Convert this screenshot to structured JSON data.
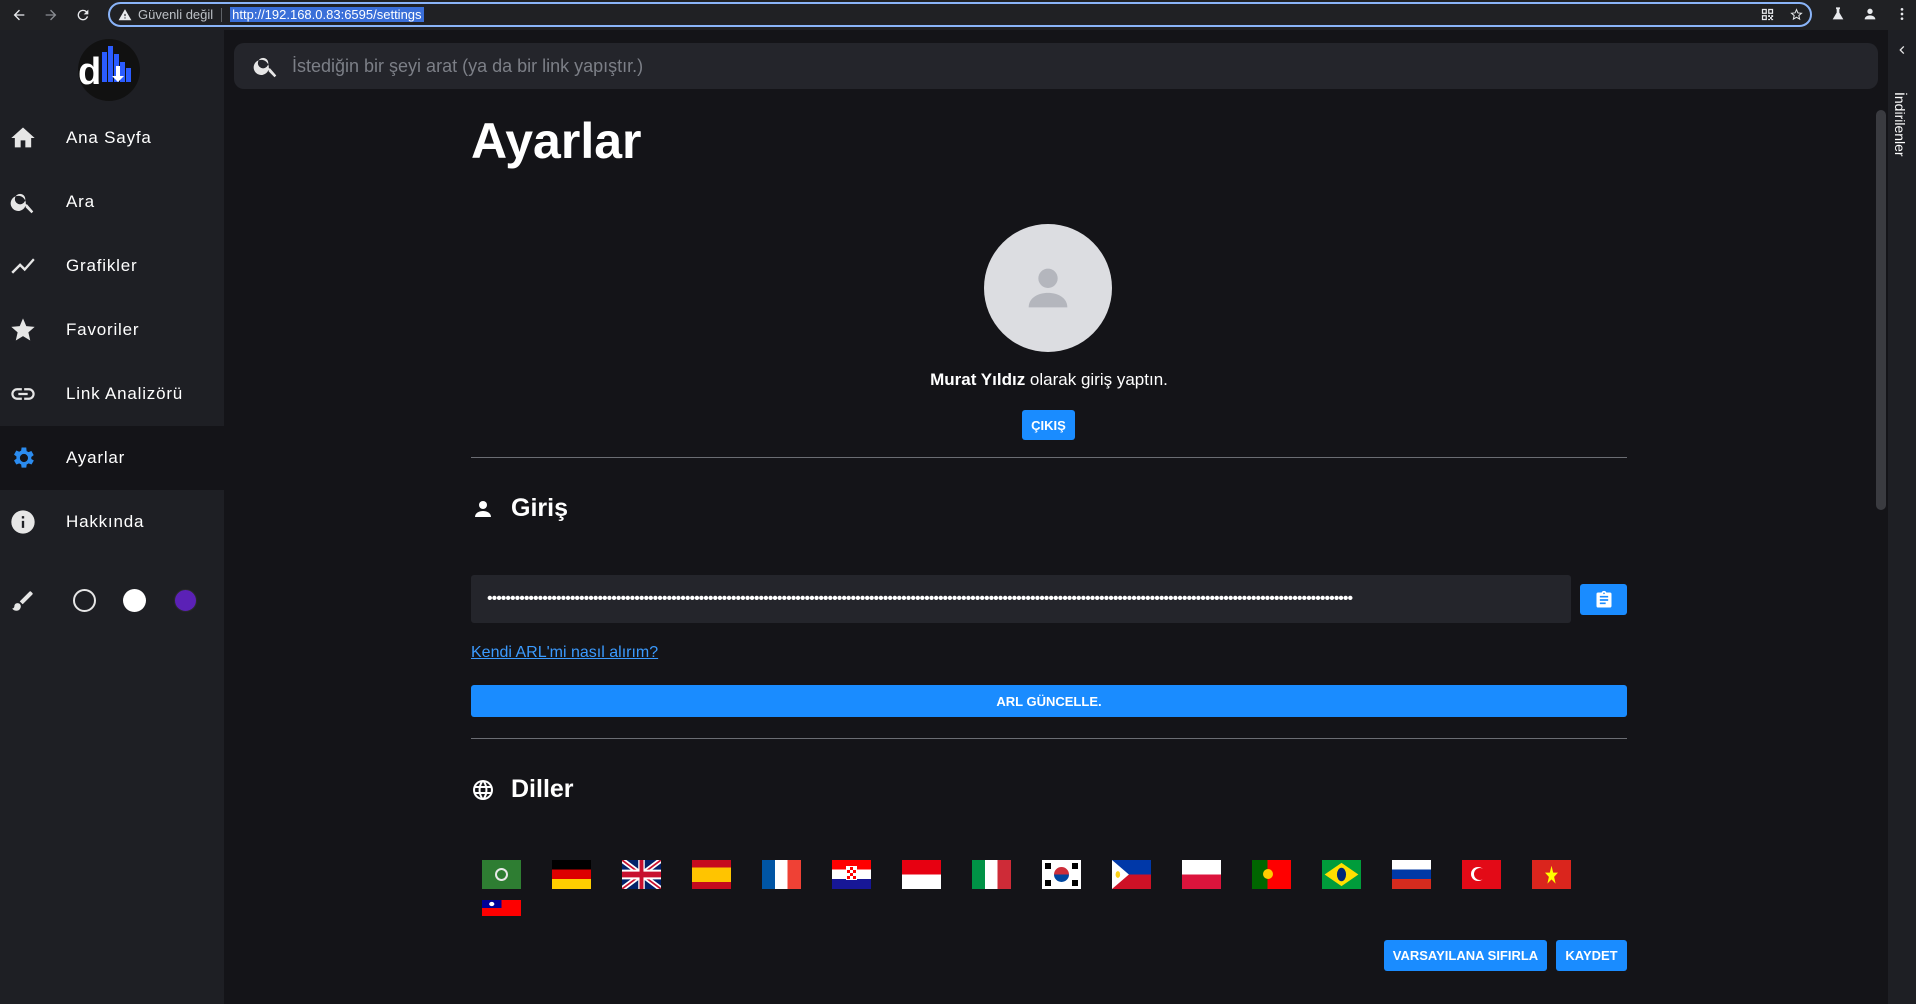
{
  "browser": {
    "security_label": "Güvenli değil",
    "url": "http://192.168.0.83:6595/settings"
  },
  "sidebar": {
    "items": [
      {
        "label": "Ana Sayfa",
        "icon": "home-icon"
      },
      {
        "label": "Ara",
        "icon": "search-icon"
      },
      {
        "label": "Grafikler",
        "icon": "chart-icon"
      },
      {
        "label": "Favoriler",
        "icon": "star-icon"
      },
      {
        "label": "Link Analizörü",
        "icon": "link-icon"
      },
      {
        "label": "Ayarlar",
        "icon": "gear-icon",
        "active": true
      },
      {
        "label": "Hakkında",
        "icon": "info-icon"
      }
    ],
    "themes": [
      "dark",
      "light",
      "purple"
    ],
    "theme_colors": [
      "#1e1f24",
      "#ffffff",
      "#5b21b6"
    ]
  },
  "search": {
    "placeholder": "İstediğin bir şeyi arat (ya da bir link yapıştır.)"
  },
  "downloads_panel": {
    "label": "İndirilenler"
  },
  "settings": {
    "title": "Ayarlar",
    "user_name": "Murat Yıldız",
    "login_suffix": " olarak giriş yaptın.",
    "logout_label": "ÇIKIŞ",
    "login_section_title": "Giriş",
    "arl_value": "••••••••••••••••••••••••••••••••••••••••••••••••••••••••••••••••••••••••••••••••••••••••••••••••••••••••••••••••••••••••••••••••••••••••••••••••••••••••••••••••••••••••••••••••••••••••••••",
    "arl_help_link": "Kendi ARL'mi nasıl alırım?",
    "arl_update_label": "ARL GÜNCELLE.",
    "languages_section_title": "Diller",
    "languages": [
      "ar",
      "de",
      "en",
      "es",
      "fr",
      "hr",
      "id",
      "it",
      "ko",
      "ph",
      "pl",
      "pt",
      "pt-br",
      "ru",
      "tr",
      "vi",
      "zh-tw"
    ],
    "reset_label": "VARSAYILANA SIFIRLA",
    "save_label": "KAYDET"
  },
  "colors": {
    "accent": "#1a8cff",
    "background": "#141418",
    "sidebar": "#1e1f24"
  }
}
